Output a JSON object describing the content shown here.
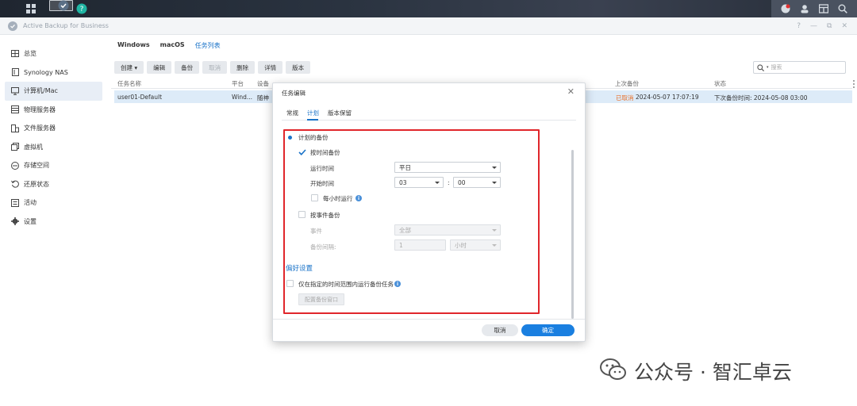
{
  "app": {
    "title": "Active Backup for Business"
  },
  "window_controls": {
    "help": "?",
    "minimize": "—",
    "restore": "⧉",
    "close": "✕"
  },
  "sidebar": {
    "items": [
      {
        "label": "总览",
        "icon": "overview-icon"
      },
      {
        "label": "Synology NAS",
        "icon": "nas-icon"
      },
      {
        "label": "计算机/Mac",
        "icon": "computer-icon"
      },
      {
        "label": "物理服务器",
        "icon": "server-icon"
      },
      {
        "label": "文件服务器",
        "icon": "file-server-icon"
      },
      {
        "label": "虚拟机",
        "icon": "vm-icon"
      },
      {
        "label": "存储空间",
        "icon": "storage-icon"
      },
      {
        "label": "还原状态",
        "icon": "restore-icon"
      },
      {
        "label": "活动",
        "icon": "activity-icon"
      },
      {
        "label": "设置",
        "icon": "gear-icon"
      }
    ],
    "active_index": 2
  },
  "main": {
    "tabs": [
      "Windows",
      "macOS",
      "任务列表"
    ],
    "active_tab": 2,
    "toolbar": {
      "create": "创建 ▾",
      "edit": "编辑",
      "backup": "备份",
      "cancel": "取消",
      "delete": "删除",
      "details": "详情",
      "version": "版本"
    },
    "search_placeholder": "搜索",
    "table": {
      "headers": [
        "任务名称",
        "平台",
        "设备",
        "上次备份",
        "状态"
      ],
      "rows": [
        {
          "name": "user01-Default",
          "platform": "Wind...",
          "device": "随神",
          "last_backup_status": "已取消",
          "last_backup_time": "2024-05-07 17:07:19",
          "state": "下次备份时间: 2024-05-08 03:00"
        }
      ]
    }
  },
  "dialog": {
    "title": "任务编辑",
    "close": "✕",
    "tabs": [
      "常规",
      "计划",
      "版本保留"
    ],
    "active_tab": 1,
    "schedule": {
      "scheduled_backup_label": "计划的备份",
      "by_time": {
        "label": "按时间备份",
        "checked": true,
        "run_time_label": "运行时间",
        "run_time_value": "平日",
        "start_time_label": "开始时间",
        "start_hour": "03",
        "colon": ":",
        "start_minute": "00",
        "hourly_label": "每小时运行",
        "hourly_checked": false
      },
      "by_event": {
        "label": "按事件备份",
        "checked": false,
        "event_label": "事件",
        "event_value": "全部",
        "interval_label": "备份间隔:",
        "interval_value": "1",
        "interval_unit": "小时"
      }
    },
    "preferences": {
      "title": "偏好设置",
      "window_only_label": "仅在指定的时间范围内运行备份任务",
      "window_only_checked": false,
      "configure_button": "配置备份窗口"
    },
    "footer": {
      "cancel": "取消",
      "ok": "确定"
    }
  },
  "watermark": {
    "text": "公众号 · 智汇卓云"
  },
  "colors": {
    "accent": "#1a73c8",
    "warn": "#e8702a",
    "highlight_border": "#e0262b",
    "primary_button": "#1a7fe0"
  }
}
